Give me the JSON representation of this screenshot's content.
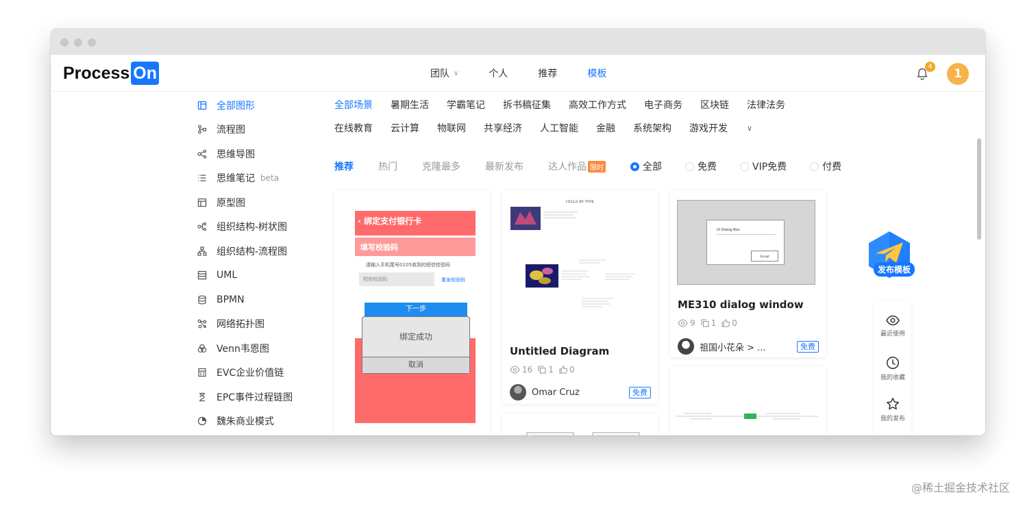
{
  "app": {
    "logo_text": "Process",
    "logo_badge": "On"
  },
  "nav": {
    "items": [
      {
        "label": "团队",
        "has_dropdown": true
      },
      {
        "label": "个人"
      },
      {
        "label": "推荐"
      },
      {
        "label": "模板",
        "active": true
      }
    ]
  },
  "header": {
    "notification_count": "4",
    "user_initial": "1"
  },
  "sidebar": {
    "items": [
      {
        "label": "全部图形",
        "icon": "all-shapes-icon",
        "active": true
      },
      {
        "label": "流程图",
        "icon": "flowchart-icon"
      },
      {
        "label": "思维导图",
        "icon": "mindmap-icon"
      },
      {
        "label": "思维笔记",
        "icon": "notes-icon",
        "tag": "beta"
      },
      {
        "label": "原型图",
        "icon": "prototype-icon"
      },
      {
        "label": "组织结构-树状图",
        "icon": "org-tree-icon"
      },
      {
        "label": "组织结构-流程图",
        "icon": "org-flow-icon"
      },
      {
        "label": "UML",
        "icon": "uml-icon"
      },
      {
        "label": "BPMN",
        "icon": "bpmn-icon"
      },
      {
        "label": "网络拓扑图",
        "icon": "network-icon"
      },
      {
        "label": "Venn韦恩图",
        "icon": "venn-icon"
      },
      {
        "label": "EVC企业价值链",
        "icon": "evc-icon"
      },
      {
        "label": "EPC事件过程链图",
        "icon": "epc-icon"
      },
      {
        "label": "魏朱商业模式",
        "icon": "business-model-icon"
      }
    ]
  },
  "scenes": {
    "row1": [
      "全部场景",
      "暑期生活",
      "学霸笔记",
      "拆书稿征集",
      "高效工作方式",
      "电子商务",
      "区块链",
      "法律法务"
    ],
    "row2": [
      "在线教育",
      "云计算",
      "物联网",
      "共享经济",
      "人工智能",
      "金融",
      "系统架构",
      "游戏开发"
    ],
    "active": "全部场景"
  },
  "filters": {
    "tabs": [
      "推荐",
      "热门",
      "克隆最多",
      "最新发布",
      "达人作品"
    ],
    "active_tab": "推荐",
    "limited_tag": "限时",
    "price": [
      "全部",
      "免费",
      "VIP免费",
      "付费"
    ],
    "active_price": "全部"
  },
  "cards": [
    {
      "thumb": {
        "header": "绑定支付银行卡",
        "subheader": "填写校验码",
        "hint": "请输入手机尾号0105收到的短信校验码",
        "input_placeholder": "短信校验码",
        "resend": "重发校验码",
        "next": "下一步",
        "dialog_msg": "绑定成功",
        "dialog_cancel": "取消"
      }
    },
    {
      "title": "Untitled Diagram",
      "views": "16",
      "clones": "1",
      "likes": "0",
      "author": "Omar Cruz",
      "tag": "免费",
      "thumb_heading": "CELLS BY TYPE"
    },
    {
      "title": "ME310 dialog window",
      "views": "9",
      "clones": "1",
      "likes": "0",
      "author": "祖国小花朵 > ...",
      "tag": "免费",
      "thumb": {
        "dialog_title": "UI Dialog Box",
        "dialog_button": "Accept"
      }
    }
  ],
  "publish": {
    "label": "发布模板"
  },
  "rightbar": {
    "items": [
      {
        "label": "最近使用",
        "icon": "eye-icon"
      },
      {
        "label": "我的收藏",
        "icon": "clock-icon"
      },
      {
        "label": "我的发布",
        "icon": "star-icon"
      }
    ]
  },
  "watermark": "@稀土掘金技术社区",
  "colors": {
    "accent": "#1677ff",
    "badge": "#f5a623",
    "card_red": "#ff6b6b",
    "limited": "#ff8a3d"
  }
}
